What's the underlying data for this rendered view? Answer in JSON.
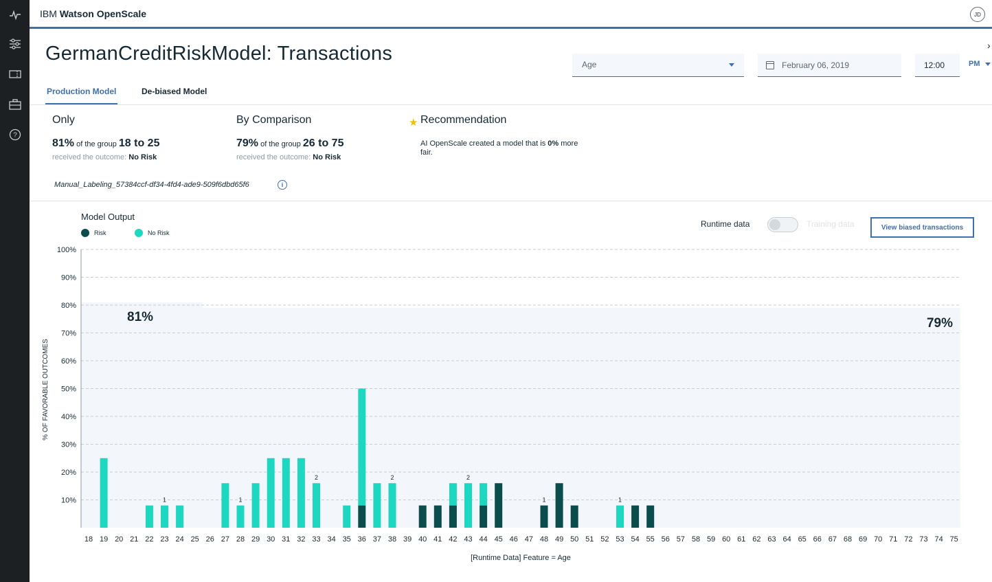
{
  "app": {
    "brand_prefix": "IBM ",
    "brand_name": "Watson OpenScale",
    "avatar_initials": "JD"
  },
  "rail": {
    "icons": [
      "activity-icon",
      "sliders-icon",
      "ticket-icon",
      "briefcase-icon",
      "help-icon"
    ]
  },
  "page": {
    "title": "GermanCreditRiskModel: Transactions"
  },
  "filters": {
    "feature": "Age",
    "date": "February 06, 2019",
    "time": "12:00",
    "ampm": "PM"
  },
  "tabs": [
    {
      "label": "Production Model",
      "active": true
    },
    {
      "label": "De-biased Model",
      "active": false
    }
  ],
  "summary": {
    "only": {
      "heading": "Only",
      "pct": "81%",
      "mid": "of the group",
      "group": "18 to 25",
      "sub": "received the outcome:",
      "outcome": "No Risk"
    },
    "comparison": {
      "heading": "By Comparison",
      "pct": "79%",
      "mid": "of the group",
      "group": "26 to 75",
      "sub": "received the outcome:",
      "outcome": "No Risk"
    },
    "recommendation": {
      "heading": "Recommendation",
      "text_a": "AI OpenScale created a model that is ",
      "pct": "0%",
      "text_b": " more fair."
    },
    "dataset_id": "Manual_Labeling_57384ccf-df34-4fd4-ade9-509f6dbd65f6"
  },
  "chart_controls": {
    "legend_title": "Model Output",
    "runtime_label": "Runtime data",
    "training_label": "Training data",
    "view_button": "View biased transactions"
  },
  "colors": {
    "risk": "#0b4c4d",
    "no_risk": "#1ed7c1",
    "accent": "#3d70b2",
    "band": "#f3f7fb"
  },
  "chart_data": {
    "type": "bar",
    "stacked": true,
    "xlabel": "[Runtime Data] Feature = Age",
    "ylabel": "% OF FAVORABLE OUTCOMES",
    "ylim": [
      0,
      100
    ],
    "yticks": [
      "10%",
      "20%",
      "30%",
      "40%",
      "50%",
      "60%",
      "70%",
      "80%",
      "90%",
      "100%"
    ],
    "grid": "dashed horizontal",
    "categories": [
      "18",
      "19",
      "20",
      "21",
      "22",
      "23",
      "24",
      "25",
      "26",
      "27",
      "28",
      "29",
      "30",
      "31",
      "32",
      "33",
      "34",
      "35",
      "36",
      "37",
      "38",
      "39",
      "40",
      "41",
      "42",
      "43",
      "44",
      "45",
      "46",
      "47",
      "48",
      "49",
      "50",
      "51",
      "52",
      "53",
      "54",
      "55",
      "56",
      "57",
      "58",
      "59",
      "60",
      "61",
      "62",
      "63",
      "64",
      "65",
      "66",
      "67",
      "68",
      "69",
      "70",
      "71",
      "72",
      "73",
      "74",
      "75"
    ],
    "series": [
      {
        "name": "Risk",
        "values": [
          0,
          0,
          0,
          0,
          0,
          0,
          0,
          0,
          0,
          0,
          0,
          0,
          0,
          0,
          0,
          0,
          0,
          0,
          8,
          0,
          0,
          0,
          8,
          8,
          8,
          0,
          8,
          16,
          0,
          0,
          8,
          16,
          8,
          0,
          0,
          0,
          8,
          8,
          0,
          0,
          0,
          0,
          0,
          0,
          0,
          0,
          0,
          0,
          0,
          0,
          0,
          0,
          0,
          0,
          0,
          0,
          0,
          0
        ]
      },
      {
        "name": "No Risk",
        "values": [
          0,
          25,
          0,
          0,
          8,
          8,
          8,
          0,
          0,
          16,
          8,
          16,
          25,
          25,
          25,
          16,
          0,
          8,
          42,
          16,
          16,
          0,
          0,
          0,
          8,
          16,
          8,
          0,
          0,
          0,
          0,
          0,
          0,
          0,
          0,
          8,
          0,
          0,
          0,
          0,
          0,
          0,
          0,
          0,
          0,
          0,
          0,
          0,
          0,
          0,
          0,
          0,
          0,
          0,
          0,
          0,
          0,
          0
        ]
      }
    ],
    "bar_labels": [
      {
        "category": "23",
        "label": "1"
      },
      {
        "category": "28",
        "label": "1"
      },
      {
        "category": "33",
        "label": "2"
      },
      {
        "category": "38",
        "label": "2"
      },
      {
        "category": "43",
        "label": "2"
      },
      {
        "category": "48",
        "label": "1"
      },
      {
        "category": "53",
        "label": "1"
      }
    ],
    "bands": [
      {
        "group": "18 to 25",
        "value": 81,
        "label": "81%",
        "from": "18",
        "to": "25"
      },
      {
        "group": "26 to 75",
        "value": 79,
        "label": "79%",
        "from": "26",
        "to": "75"
      }
    ]
  }
}
